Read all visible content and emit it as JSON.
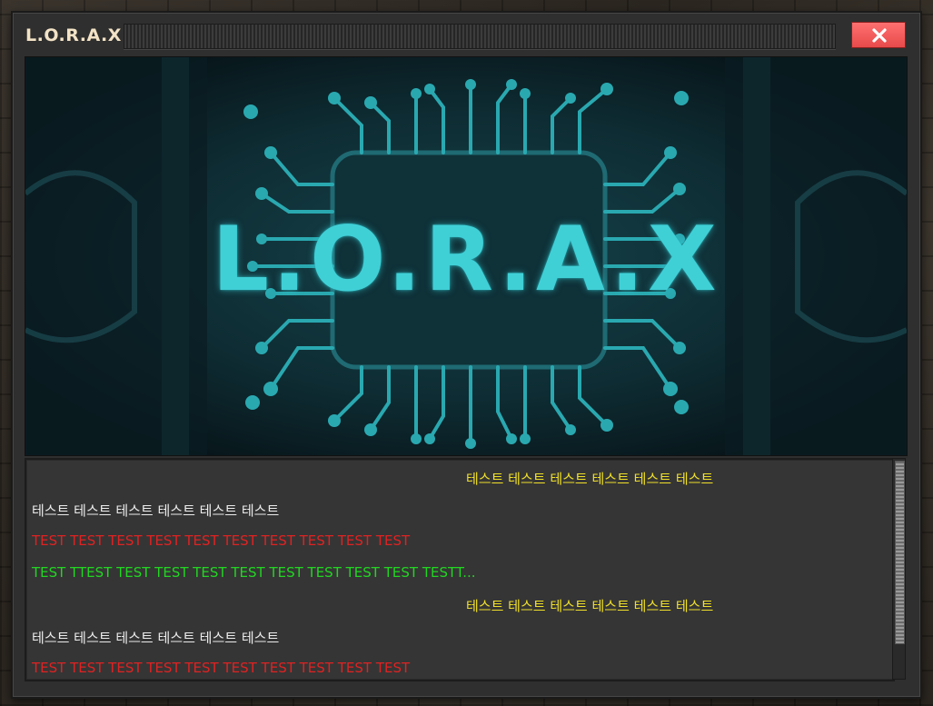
{
  "window": {
    "title": "L.O.R.A.X",
    "close_icon": "close-icon"
  },
  "banner": {
    "text": "L.O.R.A.X"
  },
  "log": {
    "lines": [
      {
        "text": "테스트 테스트 테스트 테스트 테스트 테스트",
        "color": "#f0e02a",
        "align": "center"
      },
      {
        "text": "테스트 테스트 테스트 테스트 테스트 테스트",
        "color": "#ececec",
        "align": "left"
      },
      {
        "text": "TEST TEST TEST TEST TEST TEST TEST TEST TEST TEST",
        "color": "#e02222",
        "align": "left"
      },
      {
        "text": "TEST TTEST TEST TEST TEST TEST TEST TEST TEST TEST TESTT...",
        "color": "#22d622",
        "align": "left"
      },
      {
        "text": "테스트 테스트 테스트 테스트 테스트 테스트",
        "color": "#f0e02a",
        "align": "center"
      },
      {
        "text": "테스트 테스트 테스트 테스트 테스트 테스트",
        "color": "#ececec",
        "align": "left"
      },
      {
        "text": "TEST TEST TEST TEST TEST TEST TEST TEST TEST TEST",
        "color": "#e02222",
        "align": "left"
      }
    ]
  }
}
